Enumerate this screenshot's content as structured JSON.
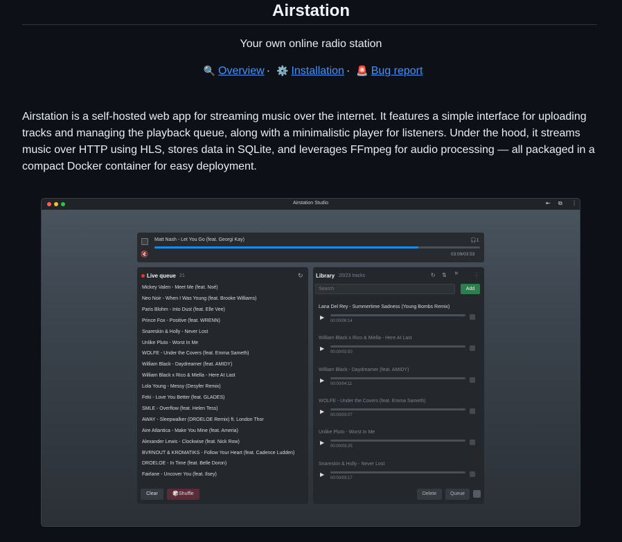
{
  "header": {
    "title": "Airstation",
    "subtitle": "Your own online radio station",
    "links": [
      {
        "icon": "🔍",
        "label": "Overview"
      },
      {
        "icon": "⚙️",
        "label": "Installation"
      },
      {
        "icon": "🚨",
        "label": "Bug report"
      }
    ],
    "separator": "·"
  },
  "description": "Airstation is a self-hosted web app for streaming music over the internet. It features a simple interface for uploading tracks and managing the playback queue, along with a minimalistic player for listeners. Under the hood, it streams music over HTTP using HLS, stores data in SQLite, and leverages FFmpeg for audio processing — all packaged in a compact Docker container for easy deployment.",
  "studio": {
    "window_title": "Airstation Studio",
    "window_dot_colors": [
      "#ff5f57",
      "#febc2e",
      "#28c840"
    ],
    "player": {
      "now_playing": "Matt Nash - Let You Go (feat. Georgi Kay)",
      "listeners": "1",
      "progress": 0.81,
      "time": "03:09/03:53",
      "accent": "#1e88e5"
    },
    "queue": {
      "title": "Live queue",
      "count": "21",
      "live_color": "#e53935",
      "items": [
        "Mickey Valen - Meet Me (feat. Noé)",
        "Neo Noir - When I Was Young (feat. Brooke Williams)",
        "Paris Blohm - Into Dust (feat. Elle Vee)",
        "Prince Fox - Positive (feat. WRENN)",
        "Snareskin & Holly - Never Lost",
        "Unlike Pluto - Worst In Me",
        "WOLFE - Under the Covers (feat. Emma Sameth)",
        "William Black - Daydreamer (feat. AMIDY)",
        "William Black x Rico & Miella - Here At Last",
        "Lola Young - Messy (Desyfer Remix)",
        "Feki - Love You Better (feat. GLADES)",
        "SMLE - Overflow (feat. Helen Tess)",
        "AWAY - Sleepwalker (DROELOE Remix) ft. London Thor",
        "Aire Atlantica - Make You Mine (feat. Ameria)",
        "Alexander Lewis - Clockwise (feat. Nick Row)",
        "BVRNOUT & KROMATIKS - Follow Your Heart (feat. Cadence Ludden)",
        "DROELOE - In Time (feat. Belle Doron)",
        "Fairlane - Uncover You (feat. Ilsey)"
      ],
      "clear_label": "Clear",
      "shuffle_label": "Shuffle",
      "shuffle_icon": "🎲"
    },
    "library": {
      "title": "Library",
      "count": "20/23 tracks",
      "search_placeholder": "Search",
      "add_label": "Add",
      "add_color": "#2e7d4f",
      "tracks": [
        {
          "name": "Lana Del Rey - Summertime Sadness (Young Bombs Remix)",
          "time": "00:00/06:14"
        },
        {
          "name": "William Black x Rico & Miella - Here At Last",
          "time": "00:00/03:50"
        },
        {
          "name": "William Black - Daydreamer (feat. AMIDY)",
          "time": "00:00/04:11"
        },
        {
          "name": "WOLFE - Under the Covers (feat. Emma Sameth)",
          "time": "00:00/03:07"
        },
        {
          "name": "Unlike Pluto - Worst In Me",
          "time": "00:00/03:25"
        },
        {
          "name": "Snareskin & Holly - Never Lost",
          "time": "00:00/03:17"
        }
      ],
      "delete_label": "Delete",
      "queue_label": "Queue"
    }
  }
}
